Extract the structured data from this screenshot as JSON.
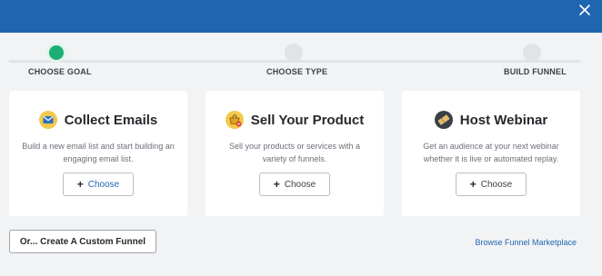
{
  "header": {
    "close_icon": "close-icon",
    "color": "#1f66b1"
  },
  "steps": [
    {
      "label": "CHOOSE GOAL",
      "active": true
    },
    {
      "label": "CHOOSE TYPE",
      "active": false
    },
    {
      "label": "BUILD FUNNEL",
      "active": false
    }
  ],
  "accent": {
    "active_step": "#1cae73",
    "link": "#1f66b1"
  },
  "cards": [
    {
      "title": "Collect Emails",
      "icon": "envelope-icon",
      "desc": "Build a new email list and start building an engaging email list.",
      "button": "Choose"
    },
    {
      "title": "Sell Your Product",
      "icon": "shopping-basket-icon",
      "desc": "Sell your products or services with a variety of funnels.",
      "button": "Choose"
    },
    {
      "title": "Host Webinar",
      "icon": "ticket-icon",
      "desc": "Get an audience at your next webinar whether it is live or automated replay.",
      "button": "Choose"
    }
  ],
  "footer": {
    "custom_funnel": "Or... Create A Custom Funnel",
    "marketplace": "Browse Funnel Marketplace"
  }
}
